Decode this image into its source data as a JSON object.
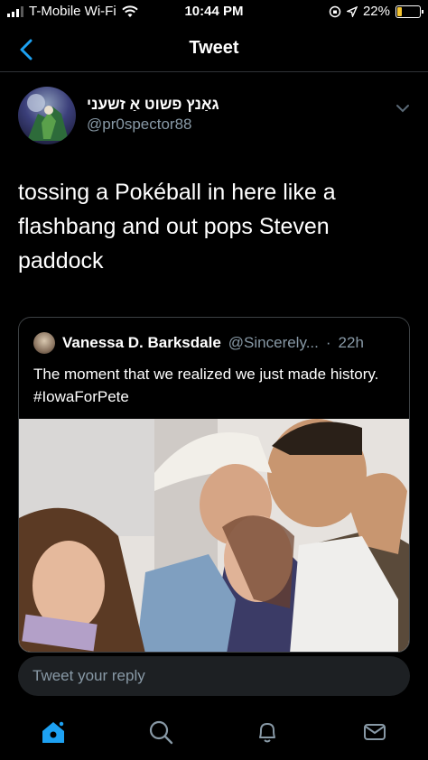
{
  "status_bar": {
    "carrier": "T-Mobile Wi-Fi",
    "time": "10:44 PM",
    "battery": "22%",
    "battery_level": 0.22,
    "battery_color": "#f4c430"
  },
  "nav": {
    "title": "Tweet",
    "back_icon": "chevron-left-icon",
    "accent": "#1da1f2"
  },
  "tweet": {
    "display_name": "גאַנץ פשוט אַ זשעני",
    "handle": "@pr0spector88",
    "text": "tossing a Pokéball in here like a flashbang and out pops Steven paddock",
    "quoted": {
      "display_name": "Vanessa D. Barksdale",
      "handle": "@Sincerely...",
      "separator": "·",
      "time": "22h",
      "text": "The moment that we realized we just made history. #IowaForPete"
    }
  },
  "reply": {
    "placeholder": "Tweet your reply"
  },
  "tab_bar": {
    "items": [
      "home-icon",
      "search-icon",
      "notifications-icon",
      "messages-icon"
    ]
  }
}
